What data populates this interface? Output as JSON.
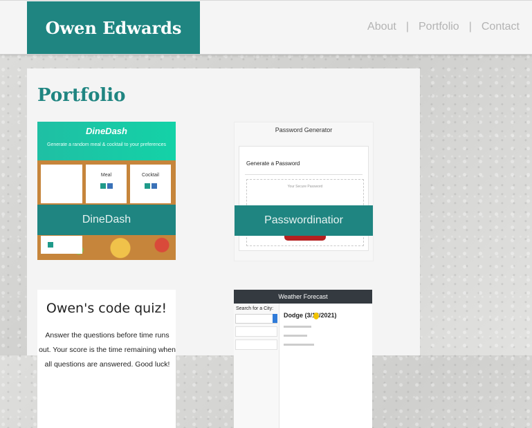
{
  "header": {
    "brand": "Owen Edwards",
    "nav": [
      {
        "label": "About"
      },
      {
        "label": "|"
      },
      {
        "label": "Portfolio"
      },
      {
        "label": "|"
      },
      {
        "label": "Contact"
      }
    ]
  },
  "main": {
    "section_title": "Portfolio",
    "projects": [
      {
        "label": "DineDash",
        "thumb": {
          "logo": "DineDash",
          "tagline": "Generate a random meal & cocktail to your preferences",
          "box1": "Meal",
          "box2": "Cocktail"
        }
      },
      {
        "label": "Passwordinatior",
        "thumb": {
          "title": "Password Generator",
          "heading": "Generate a Password",
          "placeholder": "Your Secure Password"
        }
      },
      {
        "thumb": {
          "title": "Owen's code quiz!",
          "description": "Answer the questions before time runs out. Your score is the time remaining when all questions are answered. Good luck!"
        }
      },
      {
        "thumb": {
          "bar": "Weather Forecast",
          "search_label": "Search for a City:",
          "city": "Dodge (3/12/2021)"
        }
      }
    ]
  },
  "colors": {
    "accent": "#1f8581",
    "header_bg": "#f5f5f5",
    "panel_bg": "#f4f4f4",
    "nav_text": "#b3b3b3"
  }
}
